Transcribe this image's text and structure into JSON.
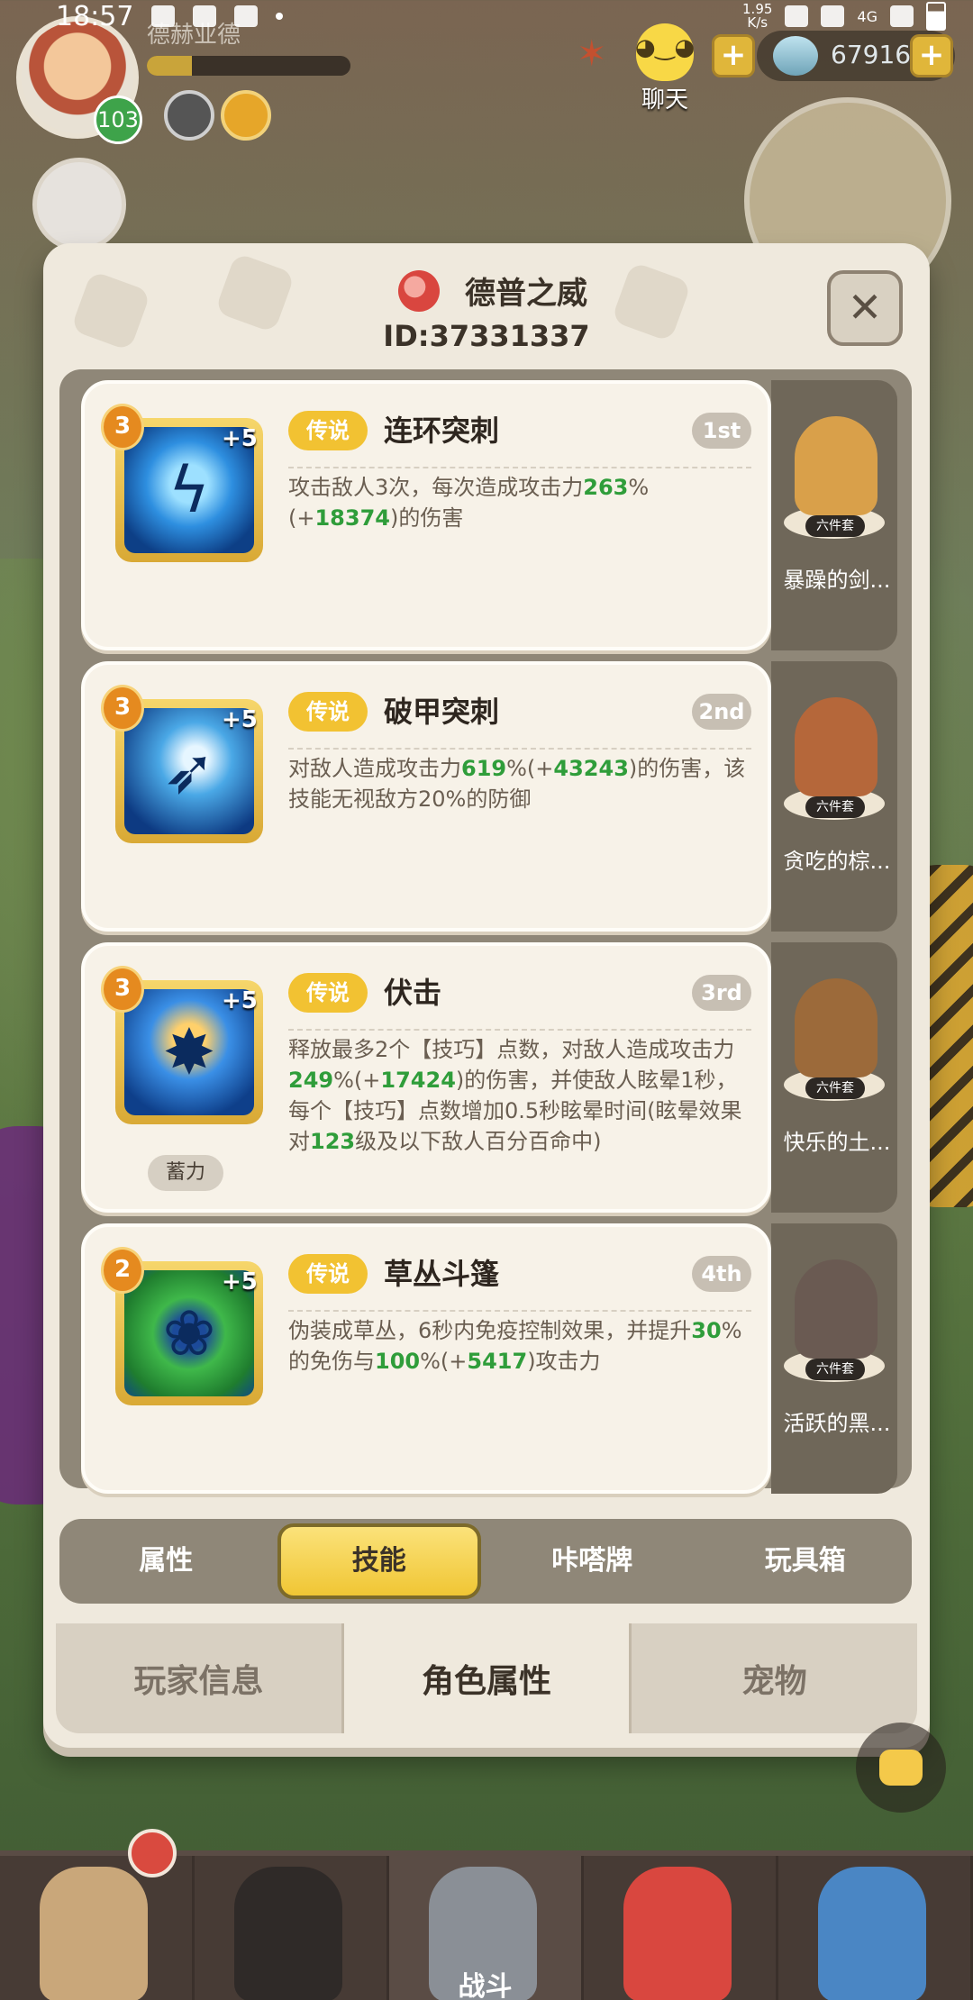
{
  "status_bar": {
    "time": "18:57",
    "net_speed_value": "1.95",
    "net_speed_unit": "K/s",
    "network": "4G"
  },
  "hud": {
    "player_name": "德赫业德",
    "level": "103",
    "xp_progress": 0.22,
    "chat_label": "聊天",
    "currency_value": "67916"
  },
  "dialog": {
    "title": "德普之威",
    "id_text": "ID:37331337",
    "close_icon": "close-icon"
  },
  "skills": [
    {
      "level": "3",
      "plus": "+5",
      "rarity": "传说",
      "name": "连环突刺",
      "rank": "1st",
      "icon": "lightning-figure-icon",
      "desc_parts": [
        "攻击敌人3次，每次造成攻击力",
        "263",
        "%(+",
        "18374",
        ")的伤害"
      ]
    },
    {
      "level": "3",
      "plus": "+5",
      "rarity": "传说",
      "name": "破甲突刺",
      "rank": "2nd",
      "icon": "pierce-strike-icon",
      "desc_parts": [
        "对敌人造成攻击力",
        "619",
        "%(+",
        "43243",
        ")的伤害，该技能无视敌方20%的防御"
      ]
    },
    {
      "level": "3",
      "plus": "+5",
      "rarity": "传说",
      "name": "伏击",
      "rank": "3rd",
      "icon": "ambush-icon",
      "charge_tag": "蓄力",
      "desc_parts": [
        "释放最多2个【技巧】点数，对敌人造成攻击力",
        "249",
        "%(+",
        "17424",
        ")的伤害，并使敌人眩晕1秒，每个【技巧】点数增加0.5秒眩晕时间(眩晕效果对",
        "123",
        "级及以下敌人百分百命中)"
      ]
    },
    {
      "level": "2",
      "plus": "+5",
      "rarity": "传说",
      "name": "草丛斗篷",
      "rank": "4th",
      "icon": "bush-cloak-icon",
      "desc_parts": [
        "伪装成草丛，6秒内免疫控制效果，并提升",
        "30",
        "%的免伤与",
        "100",
        "%(+",
        "5417",
        ")攻击力"
      ]
    }
  ],
  "pets": [
    {
      "name": "暴躁的剑...",
      "tag": "六件套",
      "color": "#d9a04a"
    },
    {
      "name": "贪吃的棕...",
      "tag": "六件套",
      "color": "#b5673a"
    },
    {
      "name": "快乐的土...",
      "tag": "六件套",
      "color": "#9c6a3a"
    },
    {
      "name": "活跃的黑...",
      "tag": "六件套",
      "color": "#6a5a52"
    }
  ],
  "sub_tabs": [
    "属性",
    "技能",
    "咔嗒牌",
    "玩具箱"
  ],
  "sub_tab_active": 1,
  "main_tabs": [
    "玩家信息",
    "角色属性",
    "宠物"
  ],
  "main_tab_active": 1,
  "bottom_nav": {
    "battle_label": "战斗"
  },
  "colors": {
    "highlight_green": "#2f9d3a",
    "rarity_gold": "#f2c232",
    "dialog_bg": "#efe9dd"
  }
}
